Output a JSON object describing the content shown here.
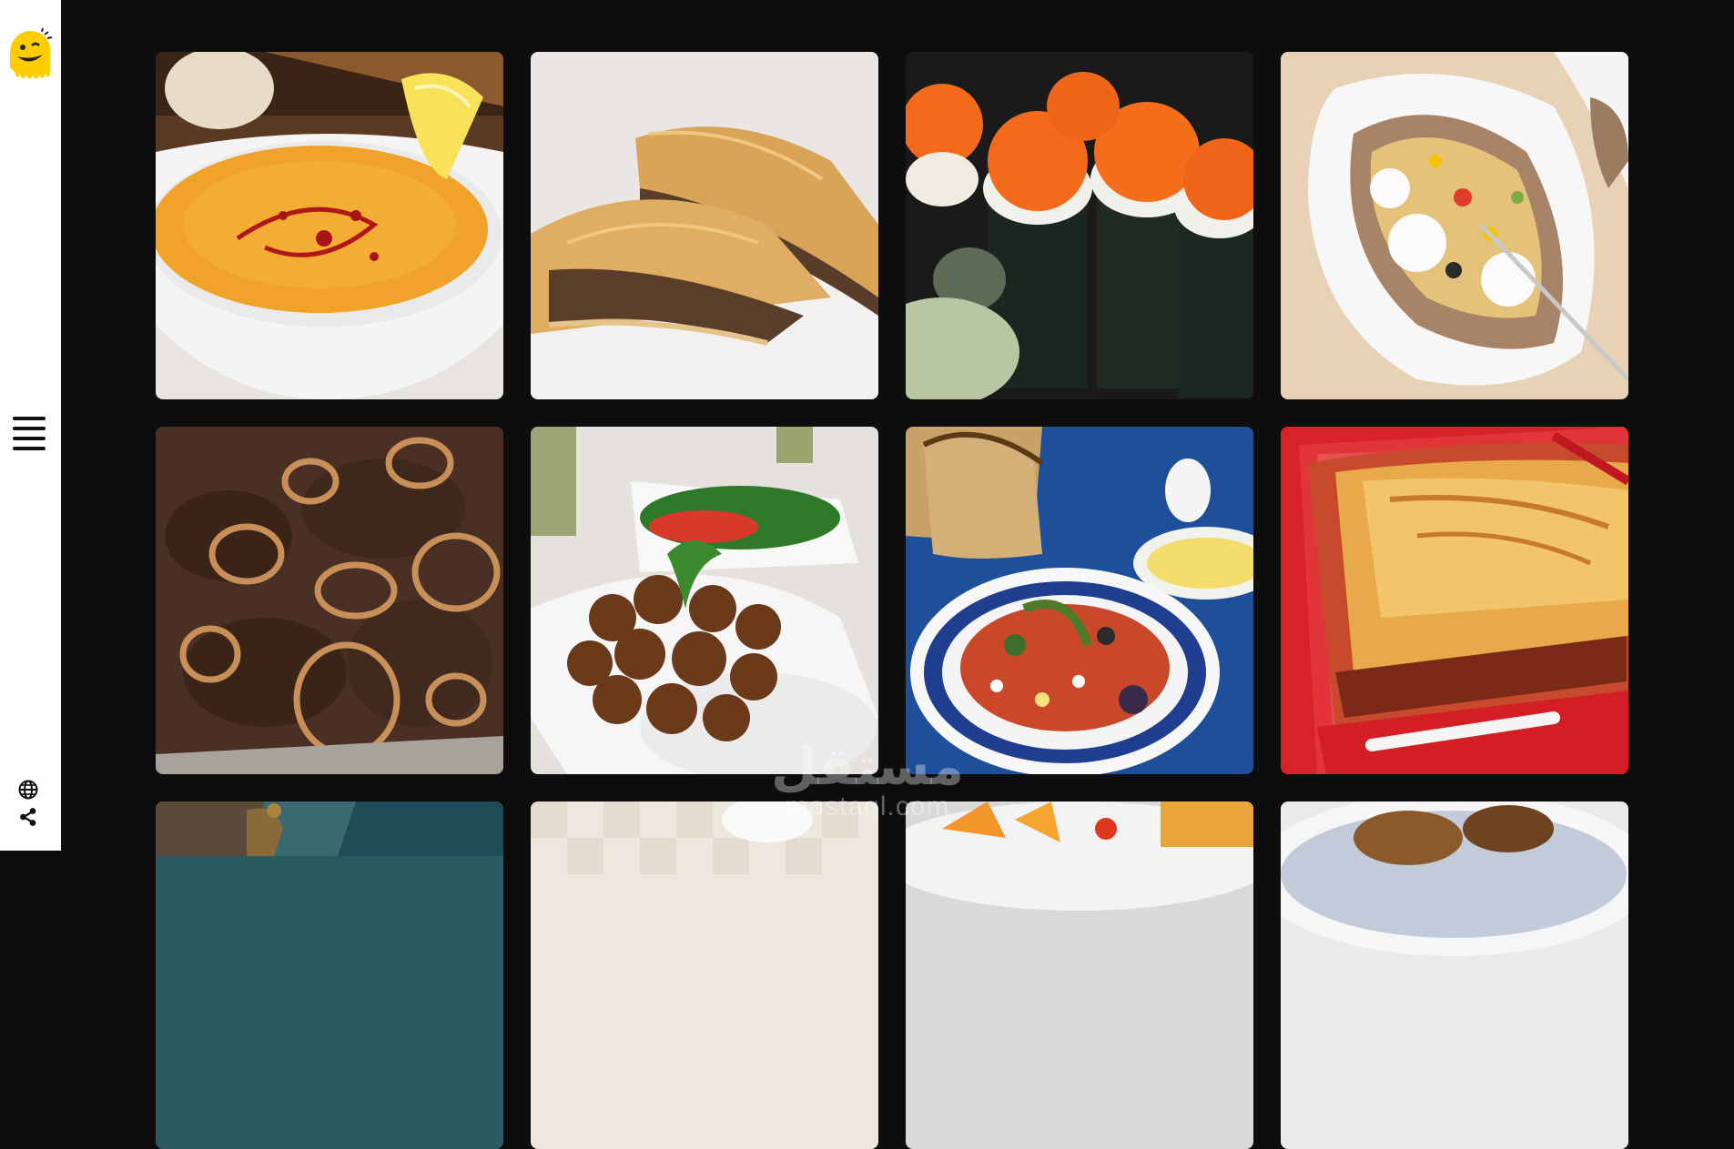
{
  "sidebar": {
    "logo_icon": "smiley-logo-icon",
    "menu_icon": "hamburger-menu-icon",
    "globe_icon": "globe-icon",
    "share_icon": "share-icon",
    "accent": "#ffcc00"
  },
  "gallery": {
    "items": [
      {
        "icon": "lentil-soup-image"
      },
      {
        "icon": "meat-pie-image"
      },
      {
        "icon": "sushi-roll-image"
      },
      {
        "icon": "stuffed-potato-image"
      },
      {
        "icon": "liver-onion-image"
      },
      {
        "icon": "falafel-image"
      },
      {
        "icon": "tunisian-salad-image"
      },
      {
        "icon": "lasagna-image"
      },
      {
        "icon": "teapot-dish-image"
      },
      {
        "icon": "white-dish-image"
      },
      {
        "icon": "fried-dish-image"
      },
      {
        "icon": "roast-dish-image"
      }
    ]
  },
  "watermark": {
    "arabic": "مستقل",
    "latin": "mostaql.com"
  }
}
